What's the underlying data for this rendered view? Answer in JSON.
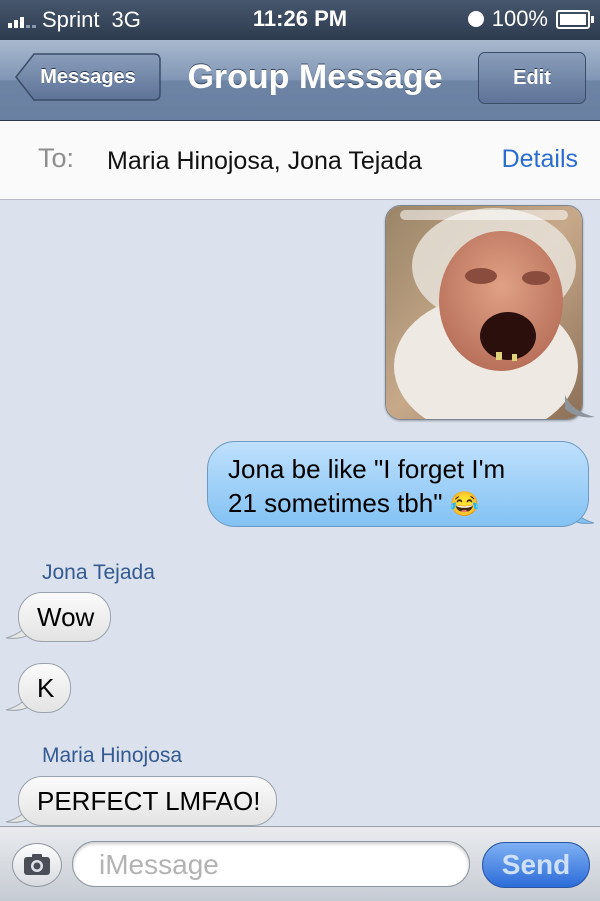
{
  "status_bar": {
    "carrier": "Sprint",
    "network": "3G",
    "time": "11:26 PM",
    "battery": "100%"
  },
  "nav": {
    "back_label": "Messages",
    "title": "Group Message",
    "edit_label": "Edit"
  },
  "recipients": {
    "to_label": "To:",
    "names": "Maria Hinojosa, Jona Tejada",
    "details_label": "Details"
  },
  "messages": [
    {
      "type": "photo",
      "direction": "outgoing"
    },
    {
      "type": "text",
      "direction": "outgoing",
      "lines": [
        "Jona be like \"I forget I'm",
        "21 sometimes tbh\""
      ],
      "emoji": "😂"
    },
    {
      "type": "sender",
      "name": "Jona Tejada"
    },
    {
      "type": "text",
      "direction": "incoming",
      "text": "Wow"
    },
    {
      "type": "text",
      "direction": "incoming",
      "text": "K"
    },
    {
      "type": "sender",
      "name": "Maria Hinojosa"
    },
    {
      "type": "text",
      "direction": "incoming",
      "text": "PERFECT LMFAO!"
    }
  ],
  "composer": {
    "placeholder": "iMessage",
    "send_label": "Send"
  },
  "colors": {
    "outgoing_bubble": "#9fd0f8",
    "incoming_bubble": "#eeeeee",
    "send_button": "#3f7be0",
    "link": "#2a6dd1"
  }
}
